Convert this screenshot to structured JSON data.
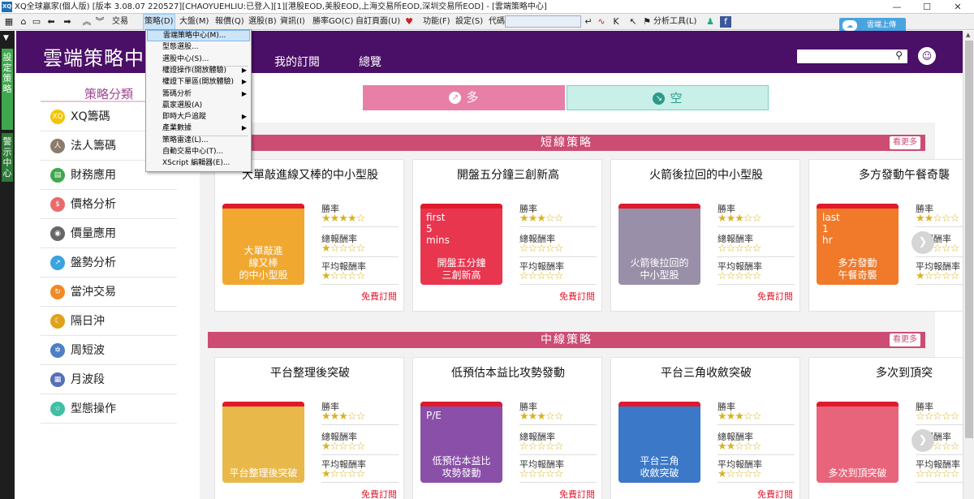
{
  "window": {
    "title": "XQ全球贏家(個人版) [版本 3.08.07 220527][CHAOYUEHLIU:已登入][1][港股EOD,美股EOD,上海交易所EOD,深圳交易所EOD] - [雲端策略中心]",
    "app_icon": "XQ"
  },
  "toolbar": {
    "menus": [
      "交易",
      "策略(D)",
      "大盤(M)",
      "報價(Q)",
      "選股(B)",
      "資訊(I)",
      "勝率GO(C)",
      "自訂頁面(U)",
      "功能(F)",
      "設定(S)"
    ],
    "code_label": "代碼",
    "analysis_tool": "分析工具(L)"
  },
  "cloud_upload": {
    "label": "雲端上傳"
  },
  "left_strip": {
    "tab1": "設定策略",
    "tab2": "警示中心"
  },
  "dropdown": {
    "items": [
      {
        "label": "雲端策略中心(M)...",
        "arrow": ""
      },
      {
        "label": "型態選股...",
        "arrow": ""
      },
      {
        "label": "選股中心(S)...",
        "arrow": ""
      },
      {
        "label": "權證操作(開放體驗)",
        "arrow": "▶"
      },
      {
        "label": "權證下單區(開放體驗)",
        "arrow": "▶"
      },
      {
        "label": "籌碼分析",
        "arrow": "▶"
      },
      {
        "label": "贏家選股(A)",
        "arrow": ""
      },
      {
        "label": "即時大戶追蹤",
        "arrow": "▶"
      },
      {
        "label": "產業數據",
        "arrow": "▶"
      },
      {
        "label": "策略雷達(L)...",
        "arrow": ""
      },
      {
        "label": "自動交易中心(T)...",
        "arrow": ""
      },
      {
        "label": "XScript 編輯器(E)...",
        "arrow": ""
      }
    ]
  },
  "header": {
    "logo": "雲端策略中",
    "nav": [
      "我的訂閱",
      "總覽"
    ],
    "search_placeholder": ""
  },
  "sidebar": {
    "title": "策略分類",
    "items": [
      {
        "label": "XQ籌碼",
        "icon": "xq-icon",
        "glyph": "XQ",
        "color": "#f2c500"
      },
      {
        "label": "法人籌碼",
        "icon": "people-icon",
        "glyph": "人",
        "color": "#8b7b6b"
      },
      {
        "label": "財務應用",
        "icon": "document-icon",
        "glyph": "▤",
        "color": "#3fa84d"
      },
      {
        "label": "價格分析",
        "icon": "dollar-icon",
        "glyph": "$",
        "color": "#e86b6b"
      },
      {
        "label": "價量應用",
        "icon": "coins-icon",
        "glyph": "◉",
        "color": "#666666"
      },
      {
        "label": "盤勢分析",
        "icon": "trend-icon",
        "glyph": "↗",
        "color": "#3aa3e0"
      },
      {
        "label": "當沖交易",
        "icon": "cycle-icon",
        "glyph": "↻",
        "color": "#f08a24"
      },
      {
        "label": "隔日沖",
        "icon": "moon-icon",
        "glyph": "☾",
        "color": "#e0a21a"
      },
      {
        "label": "周短波",
        "icon": "gear-icon",
        "glyph": "✲",
        "color": "#4d7fc4"
      },
      {
        "label": "月波段",
        "icon": "calendar-icon",
        "glyph": "▦",
        "color": "#5570b8"
      },
      {
        "label": "型態操作",
        "icon": "star-icon",
        "glyph": "☆",
        "color": "#3fbfa4"
      }
    ]
  },
  "direction_tabs": {
    "long": "多",
    "short": "空"
  },
  "sections": [
    {
      "title": "短線策略",
      "more": "看更多",
      "cards": [
        {
          "title": "大單敲進線又棒的中小型股",
          "thumb": "大單敲進\n線又棒\n的中小型股",
          "thumb_color": "#f0a830",
          "win": 4,
          "total": 1,
          "avg": 1,
          "subscribe": "免費訂閱"
        },
        {
          "title": "開盤五分鐘三創新高",
          "thumb": "開盤五分鐘\n三創新高",
          "thumb_color": "#e8364f",
          "thumb_badge": "first\n5\nmins",
          "win": 3,
          "total": 0,
          "avg": 0,
          "subscribe": "免費訂閱"
        },
        {
          "title": "火箭後拉回的中小型股",
          "thumb": "火箭後拉回的\n中小型股",
          "thumb_color": "#9a8fa8",
          "win": 3,
          "total": 0,
          "avg": 0,
          "subscribe": "免費訂閱"
        },
        {
          "title": "多方發動午餐奇襲",
          "thumb": "多方發動\n午餐奇襲",
          "thumb_color": "#f07a2a",
          "thumb_badge": "last\n1\nhr",
          "win": 2,
          "total": 0,
          "avg": 1,
          "subscribe": ""
        }
      ]
    },
    {
      "title": "中線策略",
      "more": "看更多",
      "cards": [
        {
          "title": "平台整理後突破",
          "thumb": "平台整理後突破",
          "thumb_color": "#e8b84a",
          "win": 3,
          "total": 1,
          "avg": 1,
          "subscribe": "免費訂閱"
        },
        {
          "title": "低預估本益比攻勢發動",
          "thumb": "低預估本益比\n攻勢發動",
          "thumb_color": "#8a4fa8",
          "thumb_badge": "P/E",
          "win": 3,
          "total": 0,
          "avg": 0,
          "subscribe": "免費訂閱"
        },
        {
          "title": "平台三角收斂突破",
          "thumb": "平台三角\n收斂突破",
          "thumb_color": "#3b78c8",
          "win": 3,
          "total": 2,
          "avg": 1,
          "subscribe": "免費訂閱"
        },
        {
          "title": "多次到頂突",
          "thumb": "多次到頂突破",
          "thumb_color": "#e8647a",
          "win": 0,
          "total": 0,
          "avg": 0,
          "subscribe": ""
        }
      ]
    }
  ],
  "metrics": {
    "win": "勝率",
    "total": "總報酬率",
    "avg": "平均報酬率"
  }
}
